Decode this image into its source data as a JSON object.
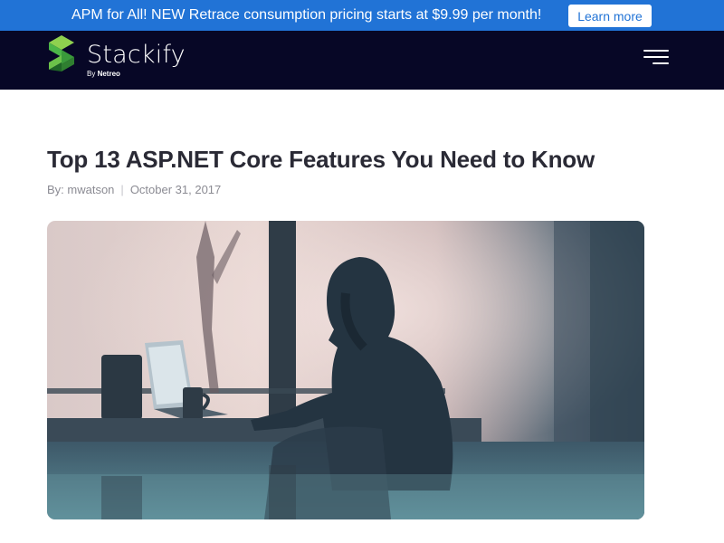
{
  "promo": {
    "text": "APM for All! NEW Retrace consumption pricing starts at $9.99 per month!",
    "button_label": "Learn more"
  },
  "nav": {
    "brand": "Stackify",
    "brand_by": "By",
    "brand_parent": "Netreo",
    "menu_icon": "hamburger-menu-icon"
  },
  "article": {
    "title": "Top 13 ASP.NET Core Features You Need to Know",
    "author_label": "By: mwatson",
    "date": "October 31, 2017",
    "hero_image": "person-at-cafe-window-with-laptop"
  },
  "colors": {
    "promo_bg": "#2173d6",
    "nav_bg": "#070726",
    "brand_green": "#4cb648",
    "title_text": "#2a2a35",
    "meta_text": "#8b8b93"
  }
}
